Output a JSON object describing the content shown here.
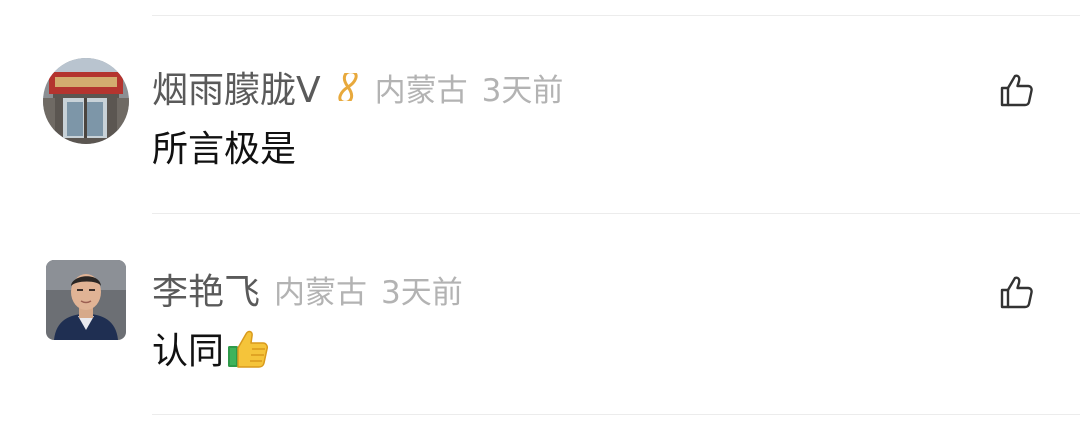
{
  "comments": [
    {
      "username": "烟雨朦胧V",
      "badge": "vip-infinity-badge",
      "location": "内蒙古",
      "time": "3天前",
      "text": "所言极是",
      "avatar": "storefront-photo"
    },
    {
      "username": "李艳飞",
      "location": "内蒙古",
      "time": "3天前",
      "text": "认同",
      "emoji": "thumbs-up-emoji",
      "avatar": "man-portrait-photo"
    }
  ],
  "icons": {
    "like": "thumbs-up-outline-icon"
  },
  "colors": {
    "username": "#5a5a5a",
    "meta": "#b3b3b3",
    "text": "#111111",
    "badge": "#e8a93c",
    "divider": "#ececec"
  }
}
